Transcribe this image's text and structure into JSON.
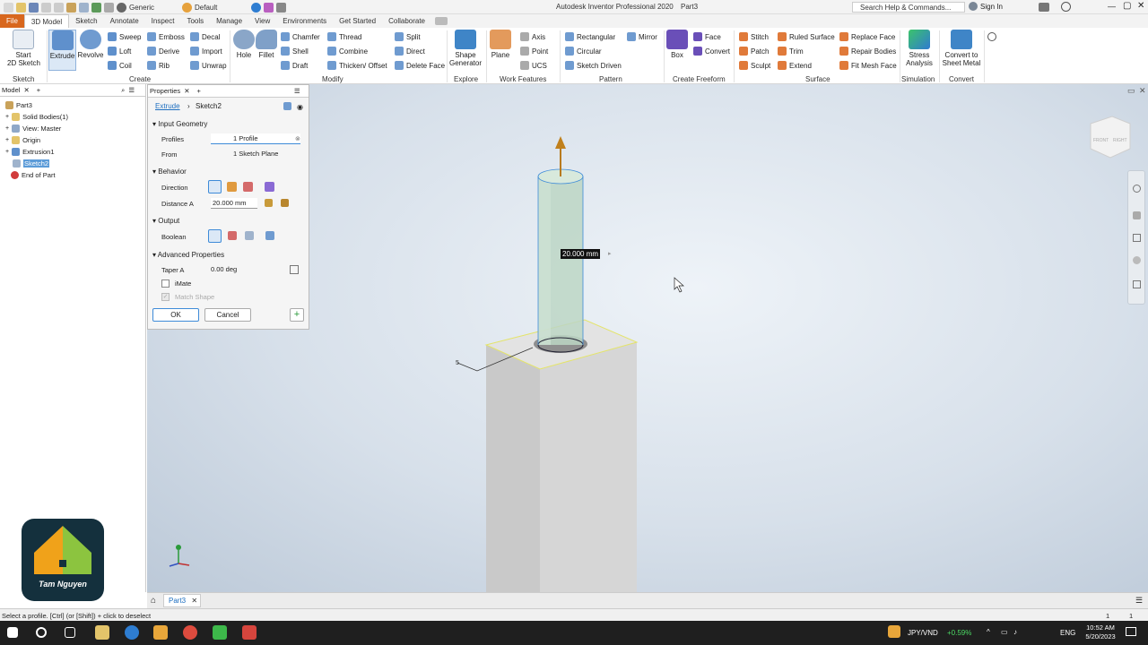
{
  "window": {
    "title": "Autodesk Inventor Professional 2020",
    "doc": "Part3",
    "appearance": "Generic",
    "view_mode": "Default",
    "search_placeholder": "Search Help & Commands...",
    "sign_in": "Sign In"
  },
  "menu_tabs": [
    "File",
    "3D Model",
    "Sketch",
    "Annotate",
    "Inspect",
    "Tools",
    "Manage",
    "View",
    "Environments",
    "Get Started",
    "Collaborate"
  ],
  "ribbon": {
    "sketch": {
      "start": "Start",
      "start2": "2D Sketch",
      "group": "Sketch"
    },
    "create": {
      "extrude": "Extrude",
      "revolve": "Revolve",
      "sweep": "Sweep",
      "loft": "Loft",
      "coil": "Coil",
      "emboss": "Emboss",
      "derive": "Derive",
      "rib": "Rib",
      "decal": "Decal",
      "import": "Import",
      "unwrap": "Unwrap",
      "group": "Create"
    },
    "modify": {
      "hole": "Hole",
      "fillet": "Fillet",
      "chamfer": "Chamfer",
      "shell": "Shell",
      "draft": "Draft",
      "thread": "Thread",
      "combine": "Combine",
      "thicken": "Thicken/ Offset",
      "split": "Split",
      "direct": "Direct",
      "delete_face": "Delete Face",
      "group": "Modify"
    },
    "explore": {
      "shape": "Shape",
      "shape2": "Generator",
      "group": "Explore"
    },
    "work": {
      "plane": "Plane",
      "axis": "Axis",
      "point": "Point",
      "ucs": "UCS",
      "group": "Work Features"
    },
    "pattern": {
      "rect": "Rectangular",
      "circ": "Circular",
      "sketch_driven": "Sketch Driven",
      "mirror": "Mirror",
      "group": "Pattern"
    },
    "freeform": {
      "box": "Box",
      "face": "Face",
      "convert": "Convert",
      "group": "Create Freeform"
    },
    "surface": {
      "stitch": "Stitch",
      "patch": "Patch",
      "sculpt": "Sculpt",
      "ruled": "Ruled Surface",
      "trim": "Trim",
      "extend": "Extend",
      "replace": "Replace Face",
      "repair": "Repair Bodies",
      "fitmesh": "Fit Mesh Face",
      "group": "Surface"
    },
    "simulation": {
      "stress": "Stress",
      "stress2": "Analysis",
      "group": "Simulation"
    },
    "convert": {
      "sheet": "Convert to",
      "sheet2": "Sheet Metal",
      "group": "Convert"
    }
  },
  "browser": {
    "tab": "Model",
    "items": [
      "Part3",
      "Solid Bodies(1)",
      "View: Master",
      "Origin",
      "Extrusion1",
      "Sketch2",
      "End of Part"
    ]
  },
  "props": {
    "tab": "Properties",
    "crumb1": "Extrude",
    "crumb2": "Sketch2",
    "input_geometry": "Input Geometry",
    "profiles_label": "Profiles",
    "profiles_value": "1 Profile",
    "from_label": "From",
    "from_value": "1 Sketch Plane",
    "behavior": "Behavior",
    "direction_label": "Direction",
    "distance_label": "Distance A",
    "distance_value": "20.000 mm",
    "output": "Output",
    "boolean_label": "Boolean",
    "advanced": "Advanced Properties",
    "taper_label": "Taper A",
    "taper_value": "0.00 deg",
    "imate": "iMate",
    "match_shape": "Match Shape",
    "ok": "OK",
    "cancel": "Cancel"
  },
  "viewport": {
    "dimension": "20.000 mm",
    "cube_front": "FRONT",
    "cube_right": "RIGHT",
    "logo_text": "Tam Nguyen",
    "sketch_num": "5"
  },
  "doc_tab": "Part3",
  "status": {
    "hint": "Select a profile. [Ctrl] (or [Shift]) + click to deselect",
    "n1": "1",
    "n2": "1"
  },
  "taskbar": {
    "currency": "JPY/VND",
    "change": "+0.59%",
    "lang": "ENG",
    "time": "10:52 AM",
    "date": "5/20/2023"
  }
}
